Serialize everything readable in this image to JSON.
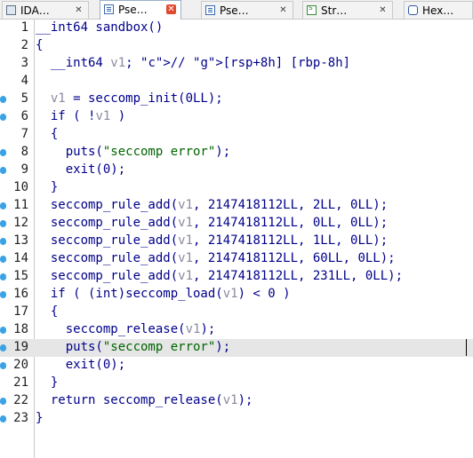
{
  "tabs": [
    {
      "label": "IDA…",
      "icon": "ida-view-icon",
      "active": false
    },
    {
      "label": "Pse…",
      "icon": "pseudocode-icon",
      "active": true
    },
    {
      "label": "Pse…",
      "icon": "pseudocode-icon",
      "active": false
    },
    {
      "label": "Str…",
      "icon": "strings-icon",
      "active": false
    },
    {
      "label": "Hex…",
      "icon": "hex-view-icon",
      "active": false
    }
  ],
  "close_glyph": "✕",
  "lines": [
    {
      "n": "1",
      "text": "__int64 sandbox()",
      "bp": false
    },
    {
      "n": "2",
      "text": "{",
      "bp": false
    },
    {
      "n": "3",
      "text": "  __int64 v1; // [rsp+8h] [rbp-8h]",
      "bp": false
    },
    {
      "n": "4",
      "text": "",
      "bp": false
    },
    {
      "n": "5",
      "text": "  v1 = seccomp_init(0LL);",
      "bp": true
    },
    {
      "n": "6",
      "text": "  if ( !v1 )",
      "bp": true
    },
    {
      "n": "7",
      "text": "  {",
      "bp": false
    },
    {
      "n": "8",
      "text": "    puts(\"seccomp error\");",
      "bp": true
    },
    {
      "n": "9",
      "text": "    exit(0);",
      "bp": true
    },
    {
      "n": "10",
      "text": "  }",
      "bp": false
    },
    {
      "n": "11",
      "text": "  seccomp_rule_add(v1, 2147418112LL, 2LL, 0LL);",
      "bp": true
    },
    {
      "n": "12",
      "text": "  seccomp_rule_add(v1, 2147418112LL, 0LL, 0LL);",
      "bp": true
    },
    {
      "n": "13",
      "text": "  seccomp_rule_add(v1, 2147418112LL, 1LL, 0LL);",
      "bp": true
    },
    {
      "n": "14",
      "text": "  seccomp_rule_add(v1, 2147418112LL, 60LL, 0LL);",
      "bp": true
    },
    {
      "n": "15",
      "text": "  seccomp_rule_add(v1, 2147418112LL, 231LL, 0LL);",
      "bp": true
    },
    {
      "n": "16",
      "text": "  if ( (int)seccomp_load(v1) < 0 )",
      "bp": true
    },
    {
      "n": "17",
      "text": "  {",
      "bp": false
    },
    {
      "n": "18",
      "text": "    seccomp_release(v1);",
      "bp": true
    },
    {
      "n": "19",
      "text": "    puts(\"seccomp error\");",
      "bp": true,
      "highlight": true
    },
    {
      "n": "20",
      "text": "    exit(0);",
      "bp": true
    },
    {
      "n": "21",
      "text": "  }",
      "bp": false
    },
    {
      "n": "22",
      "text": "  return seccomp_release(v1);",
      "bp": true
    },
    {
      "n": "23",
      "text": "}",
      "bp": true
    }
  ],
  "colors": {
    "code": "#00008b",
    "string": "#006400",
    "comment_gray": "#9a9a9a",
    "breakpoint": "#3aa3e6",
    "highlight": "#e6e6e6"
  }
}
